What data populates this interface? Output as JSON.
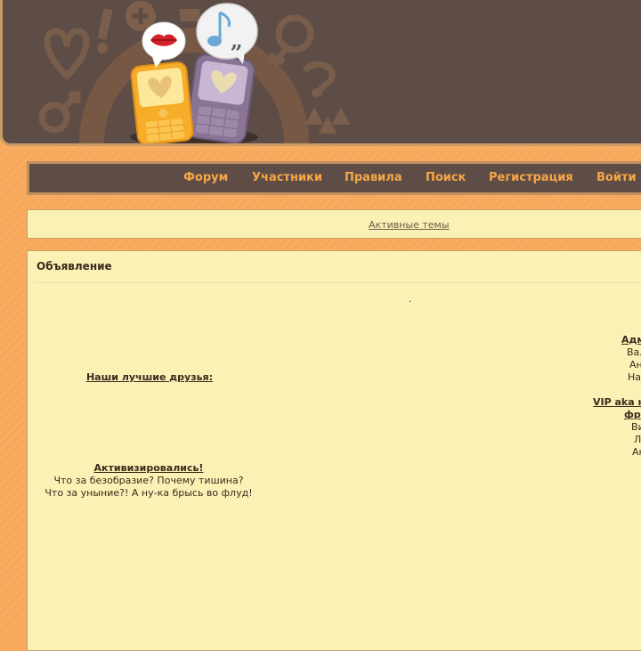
{
  "nav": {
    "items": [
      "Форум",
      "Участники",
      "Правила",
      "Поиск",
      "Регистрация",
      "Войти"
    ]
  },
  "active_topics": "Активные темы",
  "announcement": {
    "title": "Объявление",
    "dot": ".",
    "friends_heading": "Наши лучшие друзья:",
    "activated_heading": "Активизировались!",
    "activated_line1": "Что за безобразие? Почему тишина?",
    "activated_line2": "Что за уныние?! А ну-ка брысь во флуд!",
    "admins_heading": "Адм",
    "admins": [
      "Вал",
      "Ан",
      "На"
    ],
    "vip_heading": "VIP aka н",
    "vip_heading2": "фр",
    "vips": [
      "Ви",
      "Л",
      "Ан"
    ]
  },
  "colors": {
    "header_bg": "#5e4d47",
    "page_bg": "#f7a85a",
    "panel_bg": "#fcf1b5",
    "nav_text": "#f7a645"
  },
  "icons": [
    "kiss-lips-icon",
    "music-note-bubble-icon",
    "yellow-phone-icon",
    "purple-phone-icon"
  ]
}
